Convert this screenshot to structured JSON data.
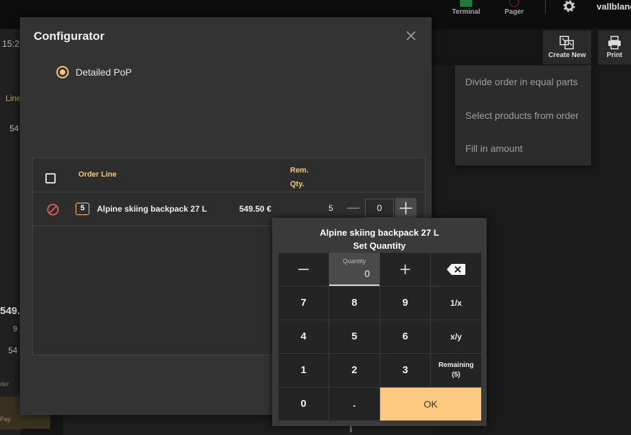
{
  "topbar": {
    "terminal_label": "Terminal",
    "pager_label": "Pager",
    "user_name": "vallblanc",
    "create_new_label": "Create New",
    "print_label": "Print"
  },
  "background": {
    "time_fragment": "15:2",
    "line_fragment": "Line",
    "amount_fragment": "54",
    "total_fragment": "549.",
    "sub1_fragment": "9",
    "sub2_fragment": "54",
    "side_fragment": "der",
    "pay_fragment": "Pay"
  },
  "menu": {
    "items": [
      {
        "label": "Divide order in equal parts"
      },
      {
        "label": "Select products from order"
      },
      {
        "label": "Fill in amount"
      }
    ]
  },
  "modal": {
    "title": "Configurator",
    "mode_label": "Detailed PoP",
    "table": {
      "col_order_line": "Order Line",
      "col_rem_qty_line1": "Rem.",
      "col_rem_qty_line2": "Qty.",
      "row": {
        "qty": "5",
        "name": "Alpine skiing backpack 27 L",
        "price": "549.50 €",
        "remaining": "5",
        "input_value": "0"
      }
    }
  },
  "keypad": {
    "title": "Alpine skiing backpack 27 L",
    "subtitle": "Set Quantity",
    "display_label": "Quantity",
    "display_value": "0",
    "keys": {
      "k7": "7",
      "k8": "8",
      "k9": "9",
      "inverse": "1/x",
      "k4": "4",
      "k5": "5",
      "k6": "6",
      "fraction": "x/y",
      "k1": "1",
      "k2": "2",
      "k3": "3",
      "remaining_line1": "Remaining",
      "remaining_line2": "(5)",
      "k0": "0",
      "dot": ".",
      "ok": "OK"
    }
  },
  "colors": {
    "accent": "#f6c87a",
    "ok_button": "#fdc980",
    "modal_bg": "#333333",
    "keypad_bg": "#3a3a3a"
  }
}
